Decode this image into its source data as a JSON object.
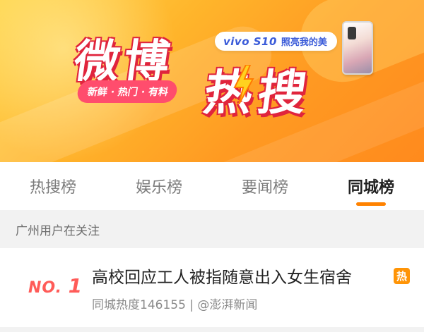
{
  "banner": {
    "title_part1": "微博",
    "title_part2": "热搜",
    "slogan": "新鲜 · 热门 · 有料",
    "sponsor_brand": "vivo S10",
    "sponsor_tagline": "照亮我的美",
    "colors": {
      "bg_start": "#ffd54a",
      "bg_end": "#ff8a1d",
      "title_shadow": "#e0243c",
      "slogan_bg": "#ff4d6d"
    }
  },
  "tabs": [
    {
      "label": "热搜榜",
      "active": false
    },
    {
      "label": "娱乐榜",
      "active": false
    },
    {
      "label": "要闻榜",
      "active": false
    },
    {
      "label": "同城榜",
      "active": true
    }
  ],
  "section": {
    "header": "广州用户在关注"
  },
  "items": [
    {
      "rank_prefix": "NO.",
      "rank_number": "1",
      "headline": "高校回应工人被指随意出入女生宿舍",
      "meta": "同城热度146155 | @澎湃新闻",
      "badge": "热"
    }
  ],
  "colors": {
    "accent": "#ff8200",
    "rank": "#ff5b58",
    "hot_badge": "#ff9406"
  },
  "icons": {
    "bolt": "lightning-bolt-icon",
    "phone": "phone-image"
  }
}
